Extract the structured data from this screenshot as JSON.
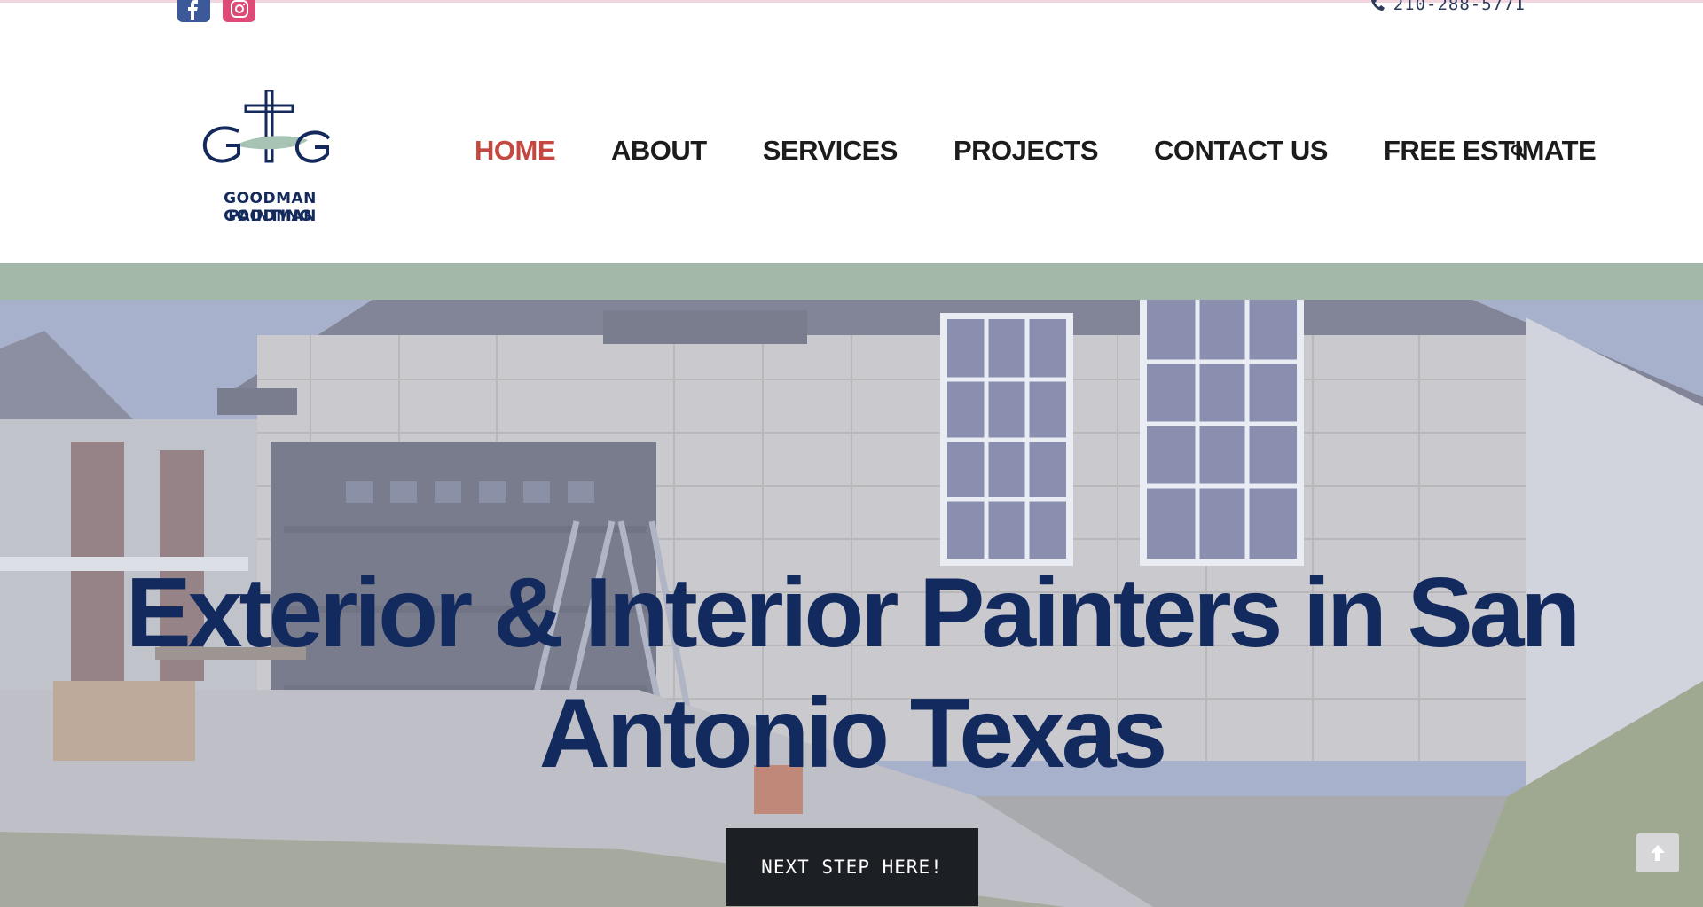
{
  "topbar": {
    "social": [
      {
        "name": "facebook",
        "icon": "facebook-icon",
        "color": "#3b5998"
      },
      {
        "name": "instagram",
        "icon": "instagram-icon",
        "color": "#dd4a76"
      }
    ],
    "phone": "210-288-5771",
    "phone_icon": "phone-icon"
  },
  "logo": {
    "line1": "GOODMAN GOODMAN",
    "line2": "PAINTING",
    "icon": "cross-logo-icon"
  },
  "nav": {
    "items": [
      {
        "label": "HOME",
        "active": true
      },
      {
        "label": "ABOUT",
        "active": false
      },
      {
        "label": "SERVICES",
        "active": false
      },
      {
        "label": "PROJECTS",
        "active": false
      },
      {
        "label": "CONTACT US",
        "active": false
      },
      {
        "label": "FREE ESTIMATE",
        "active": false
      }
    ],
    "search_icon": "search-icon",
    "active_color": "#c4483f"
  },
  "band": {
    "color": "#a3b8a8"
  },
  "hero": {
    "title": "Exterior & Interior Painters in San Antonio Texas",
    "cta_label": "NEXT STEP HERE!",
    "title_color": "#132a5e"
  },
  "scroll_top": {
    "icon": "arrow-up-icon"
  }
}
